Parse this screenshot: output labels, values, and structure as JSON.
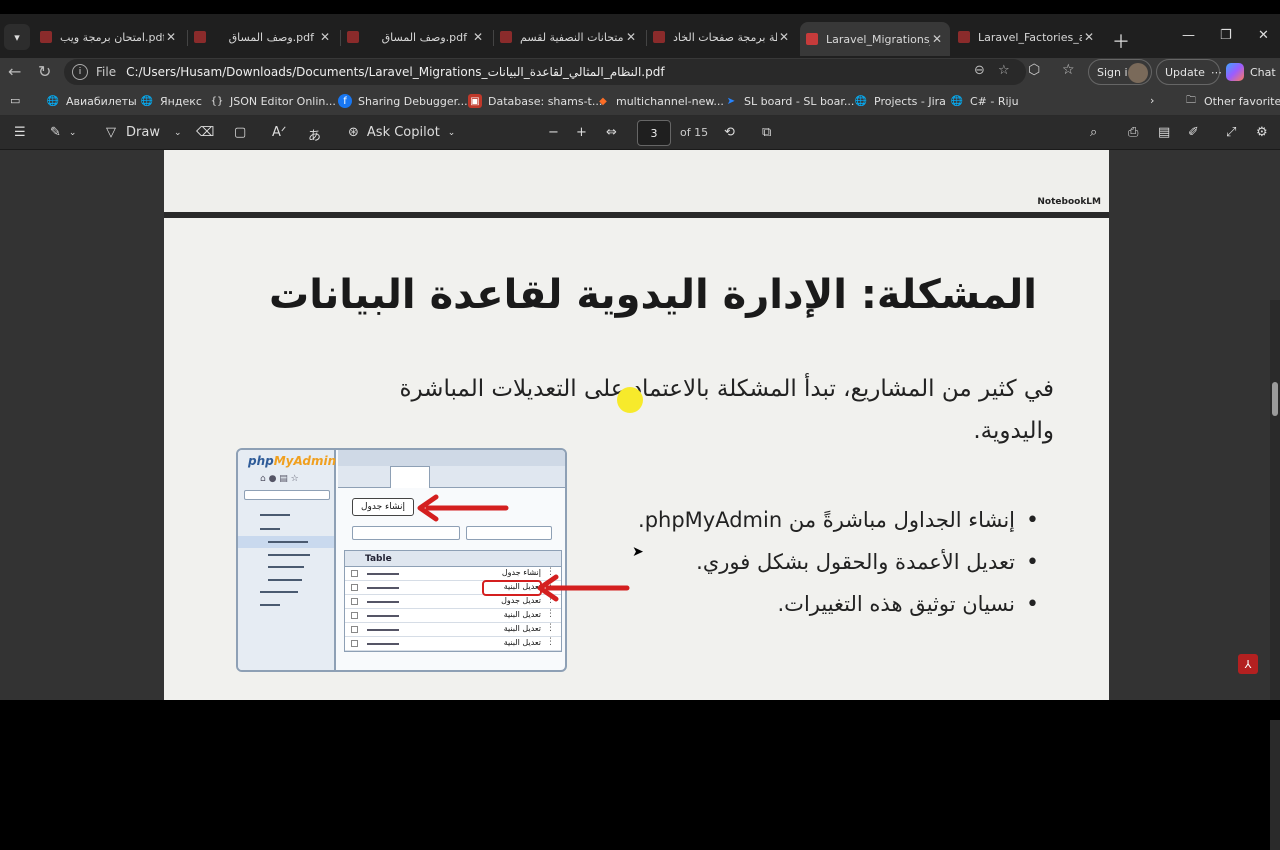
{
  "tabs": [
    {
      "label": "امتحان برمجة ويب.pdf",
      "active": false
    },
    {
      "label": "وصف المساق.pdf",
      "active": false
    },
    {
      "label": "وصف المساق.pdf",
      "active": false
    },
    {
      "label": "الامتحانات النصفية لقسم",
      "active": false
    },
    {
      "label": "خطة برمجة صفحات الخاد",
      "active": false
    },
    {
      "label": "Laravel_Migrations_ات",
      "active": true
    },
    {
      "label": "Laravel_Factories_and_S",
      "active": false
    }
  ],
  "address": {
    "scheme_label": "File",
    "url": "C:/Users/Husam/Downloads/Documents/Laravel_Migrations_النظام_المثالي_لقاعدة_البيانات.pdf"
  },
  "toolbar": {
    "signin_label": "Sign in",
    "update_label": "Update",
    "chat_label": "Chat"
  },
  "favorites": [
    {
      "label": "Авиабилеты",
      "icon": "globe-icon"
    },
    {
      "label": "Яндекс",
      "icon": "globe-icon"
    },
    {
      "label": "JSON Editor Onlin...",
      "icon": "braces-icon"
    },
    {
      "label": "Sharing Debugger...",
      "icon": "facebook-icon"
    },
    {
      "label": "Database: shams-t...",
      "icon": "database-icon"
    },
    {
      "label": "multichannel-new...",
      "icon": "gitlab-icon"
    },
    {
      "label": "SL board - SL boar...",
      "icon": "jira-icon"
    },
    {
      "label": "Projects - Jira",
      "icon": "globe-icon"
    },
    {
      "label": "C# - Riju",
      "icon": "globe-icon"
    }
  ],
  "other_favorites": "Other favorites",
  "pdf_toolbar": {
    "draw_label": "Draw",
    "copilot_label": "Ask Copilot",
    "page_current": "3",
    "page_total": "of 15"
  },
  "page_prev": {
    "brand": "NotebookLM"
  },
  "slide": {
    "title": "المشكلة: الإدارة اليدوية لقاعدة البيانات",
    "intro": "في كثير من المشاريع، تبدأ المشكلة بالاعتماد على التعديلات المباشرة واليدوية.",
    "bullets": [
      "إنشاء الجداول مباشرةً من phpMyAdmin.",
      "تعديل الأعمدة والحقول بشكل فوري.",
      "نسيان توثيق هذه التغييرات."
    ],
    "mockup": {
      "logo_php": "php",
      "logo_admin": "MyAdmin",
      "create_button": "إنشاء جدول",
      "table_header": "Table",
      "rows": [
        "إنشاء جدول",
        "تعديل البنية",
        "تعديل جدول",
        "تعديل البنية",
        "تعديل البنية",
        "تعديل البنية"
      ]
    }
  }
}
